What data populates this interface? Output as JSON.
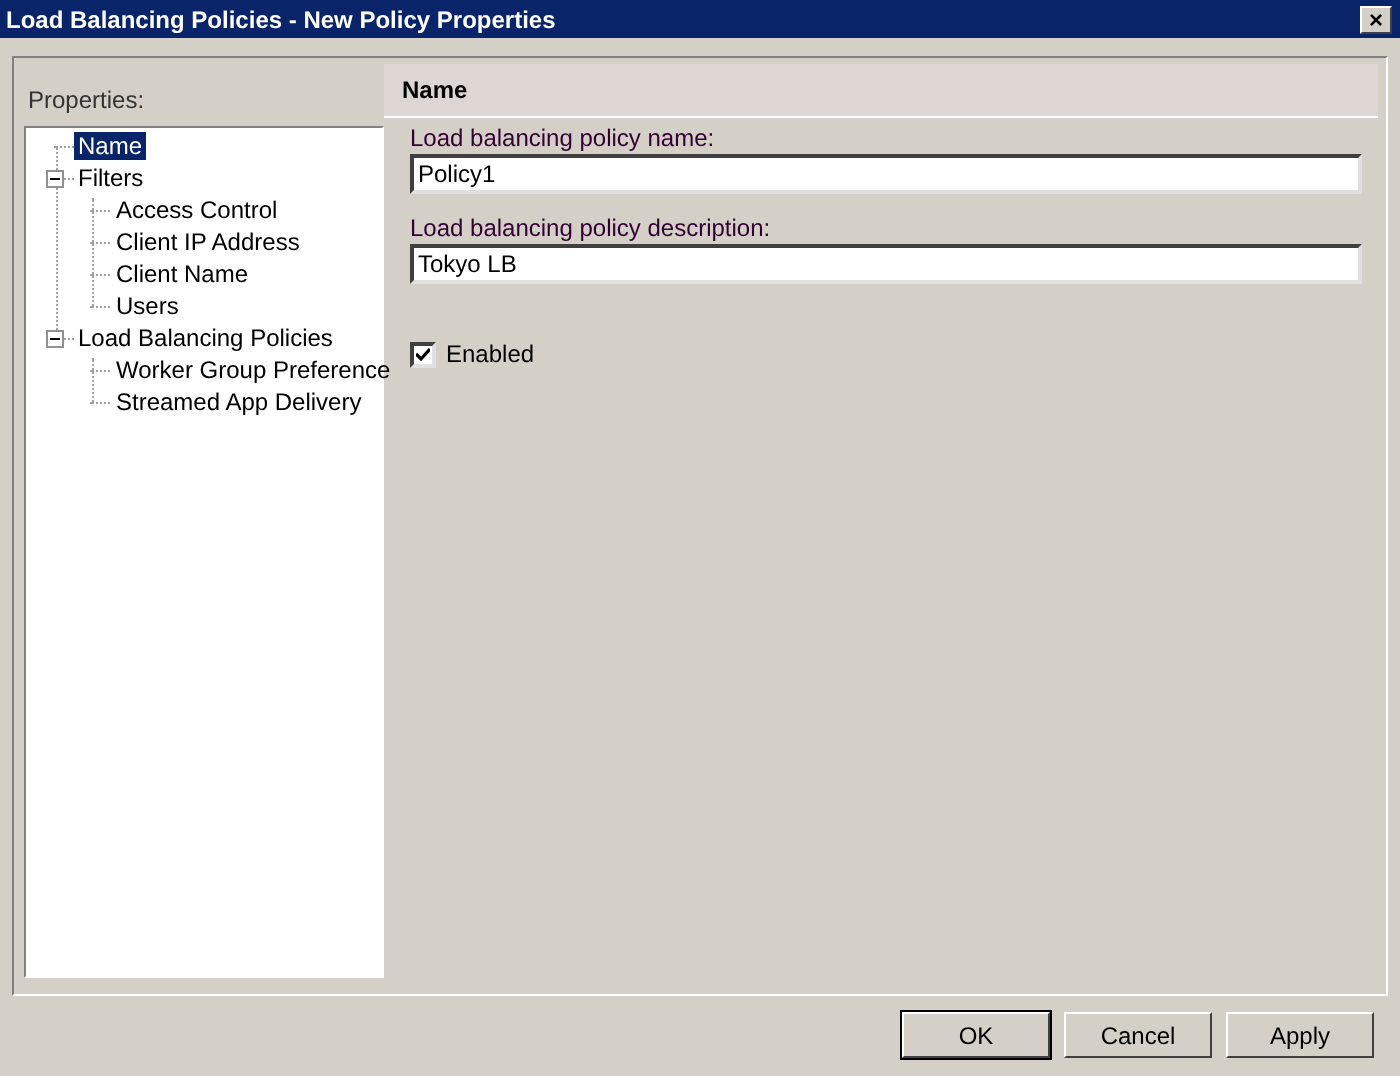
{
  "window": {
    "title": "Load Balancing Policies - New Policy Properties",
    "close": "×"
  },
  "sidebar": {
    "label": "Properties:",
    "tree": [
      {
        "label": "Name",
        "selected": true
      },
      {
        "label": "Filters",
        "selected": false,
        "expanded": true,
        "children": [
          {
            "label": "Access Control",
            "selected": false
          },
          {
            "label": "Client IP Address",
            "selected": false
          },
          {
            "label": "Client Name",
            "selected": false
          },
          {
            "label": "Users",
            "selected": false
          }
        ]
      },
      {
        "label": "Load Balancing Policies",
        "selected": false,
        "expanded": true,
        "children": [
          {
            "label": "Worker Group Preference",
            "selected": false
          },
          {
            "label": "Streamed App Delivery",
            "selected": false
          }
        ]
      }
    ]
  },
  "panel": {
    "heading": "Name",
    "fields": [
      {
        "label": "Load balancing policy name:",
        "value": "Policy1"
      },
      {
        "label": "Load balancing policy description:",
        "value": "Tokyo LB"
      }
    ],
    "checkbox": {
      "label": "Enabled",
      "checked": true
    }
  },
  "buttons": [
    {
      "label": "OK",
      "default": true
    },
    {
      "label": "Cancel",
      "default": false
    },
    {
      "label": "Apply",
      "default": false
    }
  ]
}
